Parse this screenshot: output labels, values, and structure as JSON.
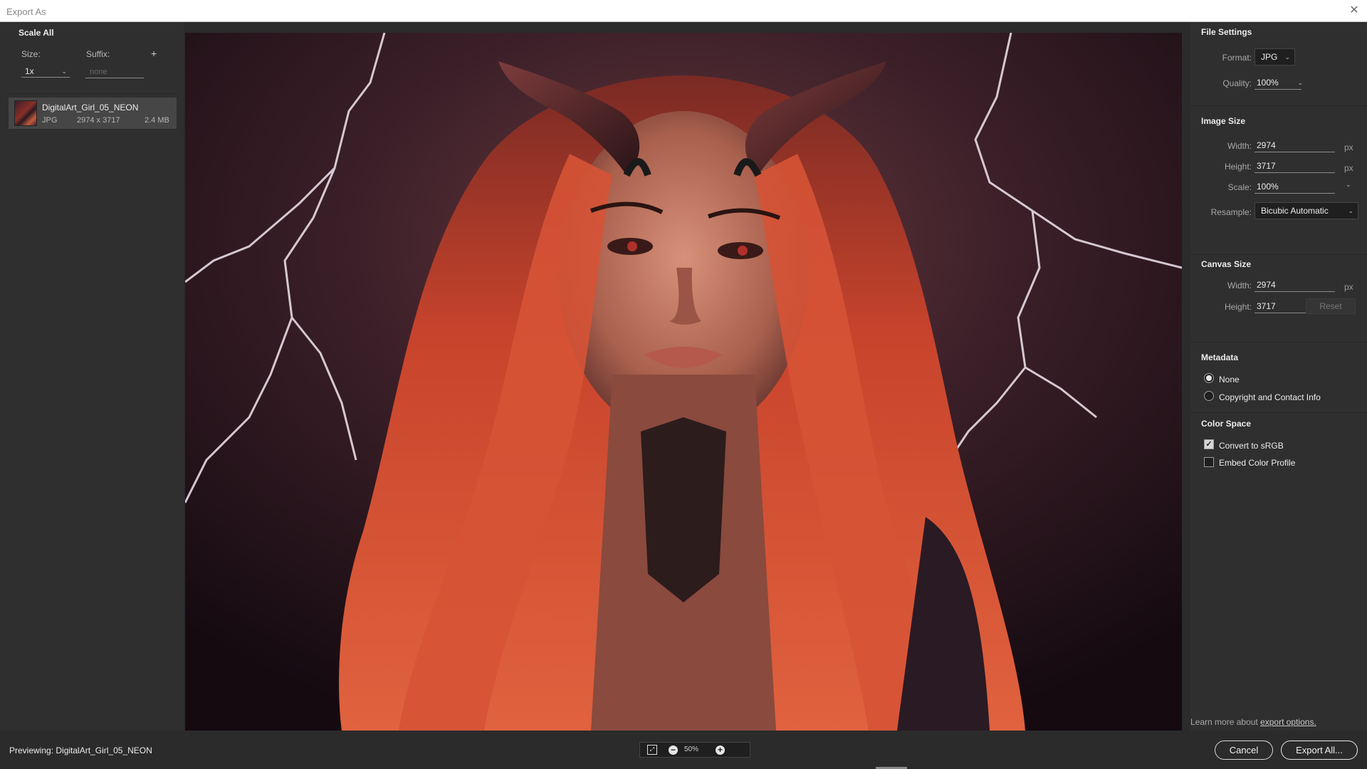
{
  "window": {
    "title": "Export As"
  },
  "left_panel": {
    "header": "Scale All",
    "size_label": "Size:",
    "suffix_label": "Suffix:",
    "size_value": "1x",
    "suffix_placeholder": "none",
    "add_icon": "plus-icon",
    "asset": {
      "name": "DigitalArt_Girl_05_NEON",
      "format": "JPG",
      "dimensions": "2974 x 3717",
      "filesize": "2.4 MB"
    }
  },
  "file_settings": {
    "header": "File Settings",
    "format_label": "Format:",
    "format_value": "JPG",
    "quality_label": "Quality:",
    "quality_value": "100%"
  },
  "image_size": {
    "header": "Image Size",
    "width_label": "Width:",
    "width_value": "2974",
    "height_label": "Height:",
    "height_value": "3717",
    "scale_label": "Scale:",
    "scale_value": "100%",
    "resample_label": "Resample:",
    "resample_value": "Bicubic Automatic",
    "unit": "px"
  },
  "canvas_size": {
    "header": "Canvas Size",
    "width_label": "Width:",
    "width_value": "2974",
    "height_label": "Height:",
    "height_value": "3717",
    "unit": "px",
    "reset_label": "Reset"
  },
  "metadata": {
    "header": "Metadata",
    "options": [
      "None",
      "Copyright and Contact Info"
    ],
    "selected": "None"
  },
  "color_space": {
    "header": "Color Space",
    "convert_label": "Convert to sRGB",
    "convert_checked": true,
    "embed_label": "Embed Color Profile",
    "embed_checked": false
  },
  "learn_more": {
    "text": "Learn more about ",
    "link": "export options."
  },
  "bottom_bar": {
    "previewing_label": "Previewing:",
    "previewing_name": "DigitalArt_Girl_05_NEON",
    "zoom_value": "50%",
    "cancel_label": "Cancel",
    "export_label": "Export All..."
  },
  "colors": {
    "panel_bg": "#2f2f2f",
    "canvas_bg": "#1e1216",
    "hair": "#c8442c",
    "lightning": "#f2e6f0"
  }
}
